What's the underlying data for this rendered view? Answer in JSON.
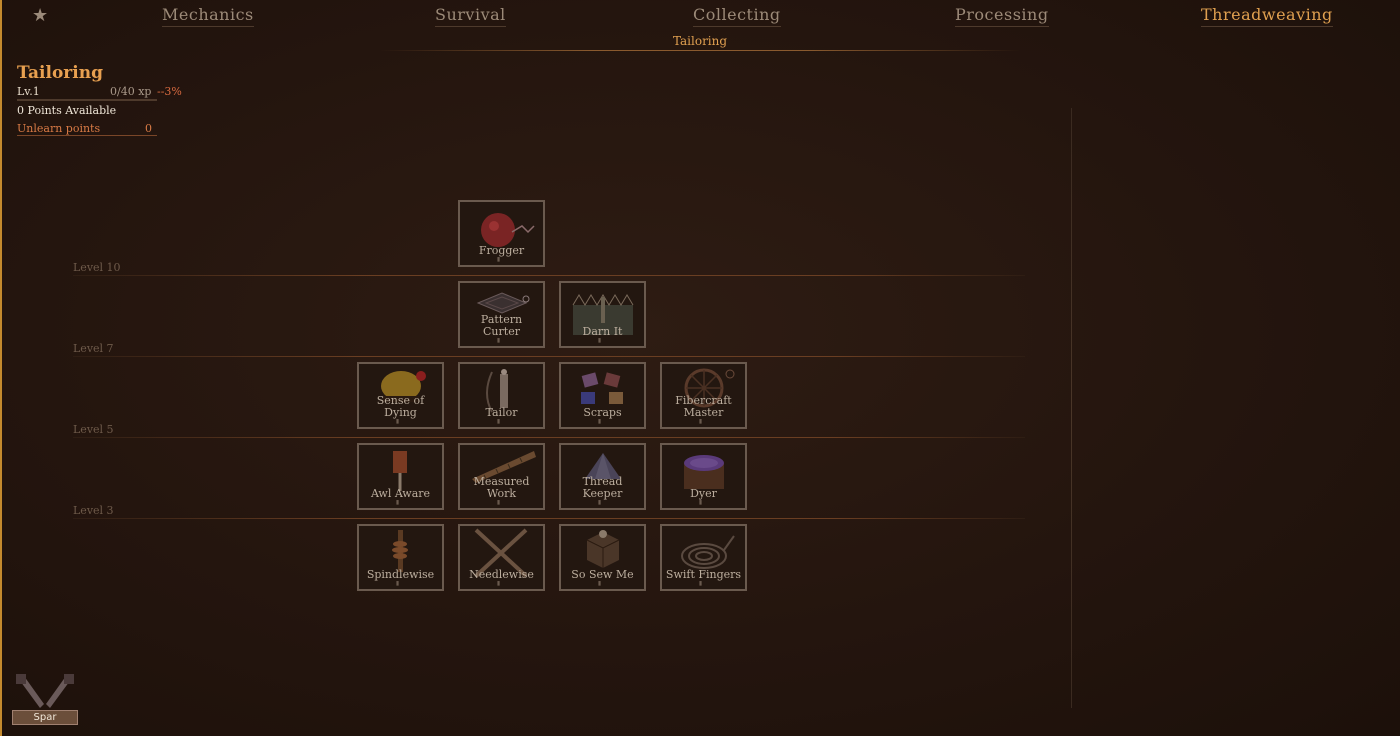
{
  "nav": {
    "favorites_icon": "star-icon",
    "tabs": [
      {
        "label": "Mechanics"
      },
      {
        "label": "Survival"
      },
      {
        "label": "Collecting"
      },
      {
        "label": "Processing"
      },
      {
        "label": "Threadweaving"
      }
    ],
    "active_tab": "Threadweaving",
    "subtab": "Tailoring",
    "accent_color": "#e0a050"
  },
  "skill": {
    "name": "Tailoring",
    "level": "Lv.1",
    "xp": "0/40 xp",
    "xp_change": "--3%",
    "points": "0 Points Available",
    "unlearn_label": "Unlearn points",
    "unlearn_value": "0"
  },
  "levels": [
    {
      "label": "Level 10"
    },
    {
      "label": "Level 7"
    },
    {
      "label": "Level 5"
    },
    {
      "label": "Level 3"
    }
  ],
  "perks": [
    {
      "label": "Frogger",
      "icon": "frogger-icon"
    },
    {
      "label": "Pattern Curter",
      "icon": "pattern-icon"
    },
    {
      "label": "Darn It",
      "icon": "darn-icon"
    },
    {
      "label": "Sense of Dying",
      "icon": "dye-sense-icon"
    },
    {
      "label": "Tailor",
      "icon": "tailor-icon"
    },
    {
      "label": "Scraps",
      "icon": "scraps-icon"
    },
    {
      "label": "Fibercraft Master",
      "icon": "spinning-wheel-icon"
    },
    {
      "label": "Awl Aware",
      "icon": "awl-icon"
    },
    {
      "label": "Measured Work",
      "icon": "measure-icon"
    },
    {
      "label": "Thread Keeper",
      "icon": "thread-icon"
    },
    {
      "label": "Dyer",
      "icon": "dye-pot-icon"
    },
    {
      "label": "Spindlewise",
      "icon": "spindle-icon"
    },
    {
      "label": "Needlewise",
      "icon": "needles-icon"
    },
    {
      "label": "So Sew Me",
      "icon": "sewing-box-icon"
    },
    {
      "label": "Swift Fingers",
      "icon": "coil-icon"
    }
  ],
  "footer": {
    "spar_label": "Spar",
    "spar_icon": "crossed-swords-icon"
  }
}
